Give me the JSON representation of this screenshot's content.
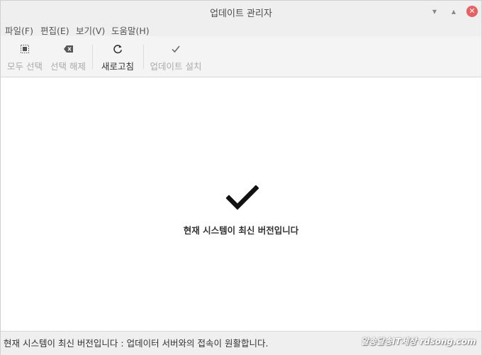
{
  "window": {
    "title": "업데이트 관리자",
    "controls": {
      "minimize": "▾",
      "maximize": "▴",
      "close": "✕"
    }
  },
  "menubar": {
    "items": [
      {
        "label": "파일(F)"
      },
      {
        "label": "편집(E)"
      },
      {
        "label": "보기(V)"
      },
      {
        "label": "도움말(H)"
      }
    ]
  },
  "toolbar": {
    "select_all": {
      "label": "모두 선택",
      "icon": "select-all-icon",
      "enabled": false
    },
    "deselect": {
      "label": "선택 해제",
      "icon": "backspace-icon",
      "enabled": false
    },
    "refresh": {
      "label": "새로고침",
      "icon": "refresh-icon",
      "enabled": true
    },
    "install": {
      "label": "업데이트 설치",
      "icon": "checkmark-icon",
      "enabled": false
    }
  },
  "main": {
    "status_icon": "checkmark-icon",
    "message": "현재 시스템이 최신 버전입니다"
  },
  "statusbar": {
    "text": "현재 시스템이 최신 버전입니다 : 업데이터 서버와의 접속이 원활합니다.",
    "watermark": "알송달송IT세상 rdsong.com"
  },
  "colors": {
    "chrome": "#efefef",
    "toolbar": "#f4f4f4",
    "close_button": "#e86060",
    "disabled_text": "#aaaaaa"
  }
}
